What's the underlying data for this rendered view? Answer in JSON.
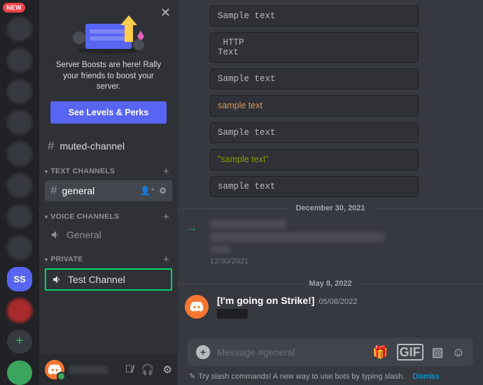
{
  "new_badge": "NEW",
  "ss_server": "SS",
  "promo": {
    "text": "Server Boosts are here! Rally your friends to boost your server.",
    "button": "See Levels & Perks"
  },
  "muted_channel": "muted-channel",
  "categories": {
    "text": "TEXT CHANNELS",
    "voice": "VOICE CHANNELS",
    "private": "PRIVATE"
  },
  "channels": {
    "general_text": "general",
    "general_voice": "General",
    "test_channel": "Test Channel"
  },
  "code_blocks": {
    "b1": "Sample text",
    "b2": " HTTP\nText",
    "b3": "Sample text",
    "b4": "sample text",
    "b5": "Sample text",
    "b6": "\"sample text\"",
    "b7": "sample text"
  },
  "dividers": {
    "d1": "December 30, 2021",
    "d2": "May 8, 2022"
  },
  "msg1_ts": "12/30/2021",
  "msg2": {
    "author": "[I'm going on Strike!]",
    "date": "05/08/2022"
  },
  "composer_placeholder": "Message #general",
  "hint_text": "Try slash commands! A new way to use bots by typing slash.",
  "hint_dismiss": "Dismiss"
}
